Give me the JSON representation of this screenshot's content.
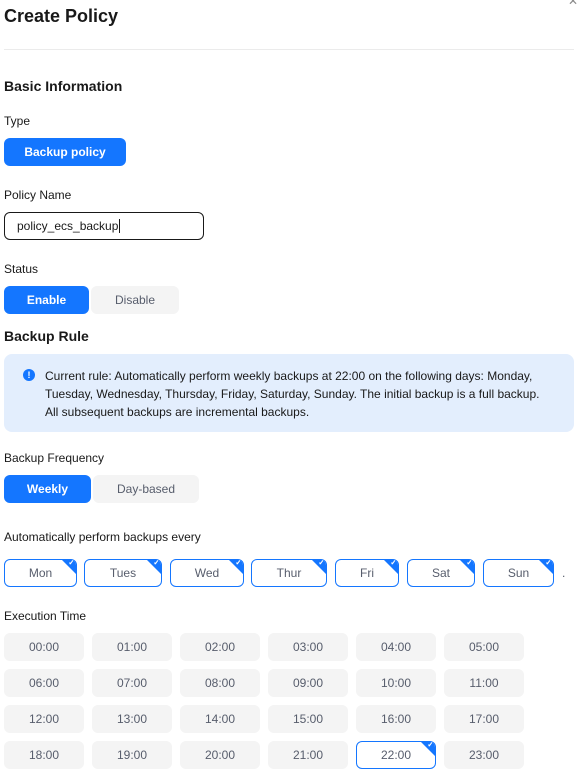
{
  "dialog": {
    "title": "Create Policy",
    "close_icon": "close-icon"
  },
  "basic_info": {
    "section_title": "Basic Information",
    "type_label": "Type",
    "type_value": "Backup policy",
    "policy_name_label": "Policy Name",
    "policy_name_value": "policy_ecs_backup",
    "status_label": "Status",
    "status_options": [
      {
        "label": "Enable",
        "selected": true
      },
      {
        "label": "Disable",
        "selected": false
      }
    ]
  },
  "backup_rule": {
    "section_title": "Backup Rule",
    "notice_icon": "info-icon",
    "notice_text": "Current rule: Automatically perform weekly backups at 22:00 on the following days: Monday, Tuesday, Wednesday, Thursday, Friday, Saturday, Sunday. The initial backup is a full backup. All subsequent backups are incremental backups.",
    "frequency_label": "Backup Frequency",
    "frequency_options": [
      {
        "label": "Weekly",
        "selected": true
      },
      {
        "label": "Day-based",
        "selected": false
      }
    ],
    "days_label": "Automatically perform backups every",
    "days": [
      {
        "label": "Mon",
        "selected": true
      },
      {
        "label": "Tues",
        "selected": true
      },
      {
        "label": "Wed",
        "selected": true
      },
      {
        "label": "Thur",
        "selected": true
      },
      {
        "label": "Fri",
        "selected": true
      },
      {
        "label": "Sat",
        "selected": true
      },
      {
        "label": "Sun",
        "selected": true
      }
    ],
    "days_suffix": ".",
    "execution_time_label": "Execution Time",
    "times": [
      {
        "label": "00:00",
        "selected": false
      },
      {
        "label": "01:00",
        "selected": false
      },
      {
        "label": "02:00",
        "selected": false
      },
      {
        "label": "03:00",
        "selected": false
      },
      {
        "label": "04:00",
        "selected": false
      },
      {
        "label": "05:00",
        "selected": false
      },
      {
        "label": "06:00",
        "selected": false
      },
      {
        "label": "07:00",
        "selected": false
      },
      {
        "label": "08:00",
        "selected": false
      },
      {
        "label": "09:00",
        "selected": false
      },
      {
        "label": "10:00",
        "selected": false
      },
      {
        "label": "11:00",
        "selected": false
      },
      {
        "label": "12:00",
        "selected": false
      },
      {
        "label": "13:00",
        "selected": false
      },
      {
        "label": "14:00",
        "selected": false
      },
      {
        "label": "15:00",
        "selected": false
      },
      {
        "label": "16:00",
        "selected": false
      },
      {
        "label": "17:00",
        "selected": false
      },
      {
        "label": "18:00",
        "selected": false
      },
      {
        "label": "19:00",
        "selected": false
      },
      {
        "label": "20:00",
        "selected": false
      },
      {
        "label": "21:00",
        "selected": false
      },
      {
        "label": "22:00",
        "selected": true
      },
      {
        "label": "23:00",
        "selected": false
      }
    ]
  },
  "colors": {
    "accent": "#1476ff",
    "notice_bg": "#e3eefd",
    "unselected_bg": "#f4f4f4"
  }
}
